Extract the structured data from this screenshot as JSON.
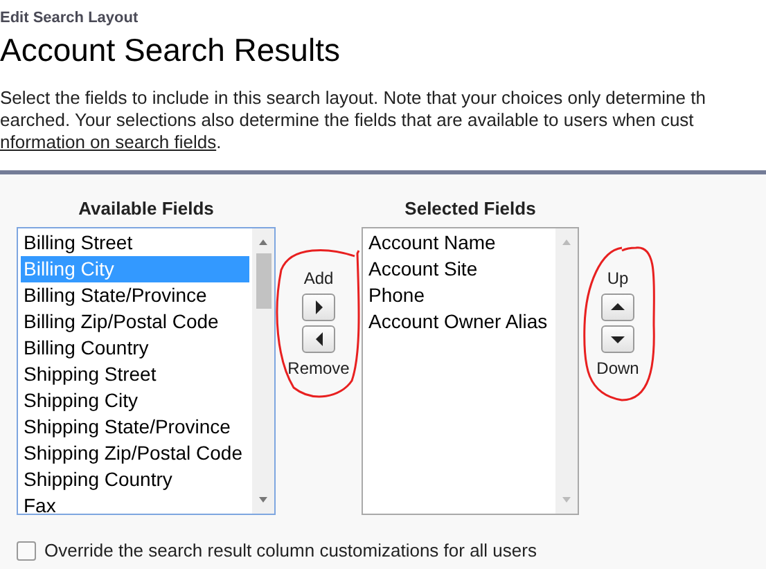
{
  "breadcrumb": "Edit Search Layout",
  "title": "Account Search Results",
  "description": {
    "lines": [
      "Select the fields to include in this search layout. Note that your choices only determine th",
      "earched. Your selections also determine the fields that are available to users when cust"
    ],
    "link": "nformation on search fields",
    "tail": "."
  },
  "available_fields": {
    "heading": "Available Fields",
    "items": [
      {
        "label": "Billing Street",
        "selected": false
      },
      {
        "label": "Billing City",
        "selected": true
      },
      {
        "label": "Billing State/Province",
        "selected": false
      },
      {
        "label": "Billing Zip/Postal Code",
        "selected": false
      },
      {
        "label": "Billing Country",
        "selected": false
      },
      {
        "label": "Shipping Street",
        "selected": false
      },
      {
        "label": "Shipping City",
        "selected": false
      },
      {
        "label": "Shipping State/Province",
        "selected": false
      },
      {
        "label": "Shipping Zip/Postal Code",
        "selected": false
      },
      {
        "label": "Shipping Country",
        "selected": false
      },
      {
        "label": "Fax",
        "selected": false
      }
    ]
  },
  "add_remove": {
    "top_label": "Add",
    "bottom_label": "Remove",
    "circled": true
  },
  "selected_fields": {
    "heading": "Selected Fields",
    "items": [
      {
        "label": "Account Name",
        "selected": false
      },
      {
        "label": "Account Site",
        "selected": false
      },
      {
        "label": "Phone",
        "selected": false
      },
      {
        "label": "Account Owner Alias",
        "selected": false
      }
    ]
  },
  "up_down": {
    "top_label": "Up",
    "bottom_label": "Down",
    "circled": true
  },
  "override": {
    "label": "Override the search result column customizations for all users",
    "checked": false
  }
}
